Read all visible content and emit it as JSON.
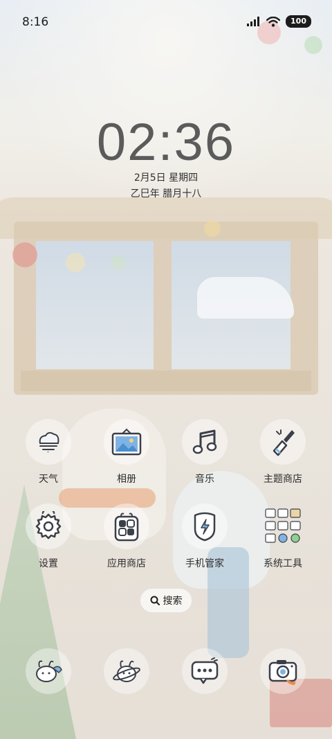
{
  "status_bar": {
    "time": "8:16",
    "battery": "100",
    "icons": [
      "signal-icon",
      "wifi-icon",
      "battery-icon"
    ]
  },
  "lock_clock": {
    "time": "02:36",
    "date": "2月5日 星期四",
    "lunar": "乙巳年 腊月十八"
  },
  "apps": [
    {
      "label": "天气",
      "icon": "weather-icon"
    },
    {
      "label": "相册",
      "icon": "gallery-icon"
    },
    {
      "label": "音乐",
      "icon": "music-icon"
    },
    {
      "label": "主题商店",
      "icon": "theme-store-icon"
    },
    {
      "label": "设置",
      "icon": "settings-icon"
    },
    {
      "label": "应用商店",
      "icon": "app-store-icon"
    },
    {
      "label": "手机管家",
      "icon": "phone-manager-icon"
    },
    {
      "label": "系统工具",
      "icon": "system-tools-folder-icon"
    }
  ],
  "search": {
    "label": "搜索"
  },
  "dock": [
    {
      "icon": "phone-icon"
    },
    {
      "icon": "browser-icon"
    },
    {
      "icon": "messages-icon"
    },
    {
      "icon": "camera-icon"
    }
  ],
  "colors": {
    "icon_ink": "#3a3f48",
    "icon_blue": "#4a8fd0",
    "accent_orange": "#e98a4a",
    "clock_text": "#5b5b5b"
  }
}
